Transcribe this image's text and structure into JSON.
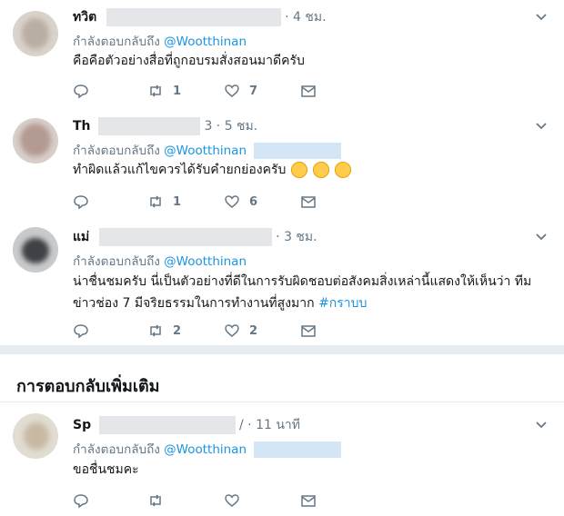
{
  "colors": {
    "link": "#1b95e0",
    "meta": "#657786",
    "text": "#14171a",
    "border": "#e6ecf0"
  },
  "icons": {
    "reply": "reply-icon",
    "retweet": "retweet-icon",
    "like": "heart-icon",
    "dm": "envelope-icon",
    "more": "chevron-down-icon"
  },
  "section_title": "การตอบกลับเพิ่มเติม",
  "tweets": [
    {
      "name": "ทวิต",
      "time": "· 4 ชม.",
      "replying_prefix": "กำลังตอบกลับถึง",
      "replying_handle": "@Woot​thinan",
      "text": "คือคือตัวอย่างสื่อที่ถูกอบรมสั่งสอนมาดีครับ",
      "hashtag": "",
      "retweets": "1",
      "likes": "7"
    },
    {
      "name": "Th",
      "time": "3 · 5 ชม.",
      "replying_prefix": "กำลังตอบกลับถึง",
      "replying_handle": "@Woot​thinan",
      "text": "ทำผิดแล้วแก้ไขควรได้รับคำยกย่องครับ",
      "hashtag": "",
      "retweets": "1",
      "likes": "6"
    },
    {
      "name": "แม่",
      "time": "· 3 ชม.",
      "replying_prefix": "กำลังตอบกลับถึง",
      "replying_handle": "@Woot​thinan",
      "text": "น่าชื่นชมครับ นี่เป็นตัวอย่างที่ดีในการรับผิดชอบต่อสังคมสิ่งเหล่านี้แสดงให้เห็นว่า ทีมข่าวช่อง 7 มีจริยธรรมในการทำงานที่สูงมาก",
      "hashtag": "#กราบบ",
      "retweets": "2",
      "likes": "2"
    },
    {
      "name": "Sp",
      "time": "/ · 11 นาที",
      "replying_prefix": "กำลังตอบกลับถึง",
      "replying_handle": "@Woot​thinan",
      "text": "ขอชื่นชมคะ",
      "hashtag": "",
      "retweets": "",
      "likes": ""
    }
  ]
}
